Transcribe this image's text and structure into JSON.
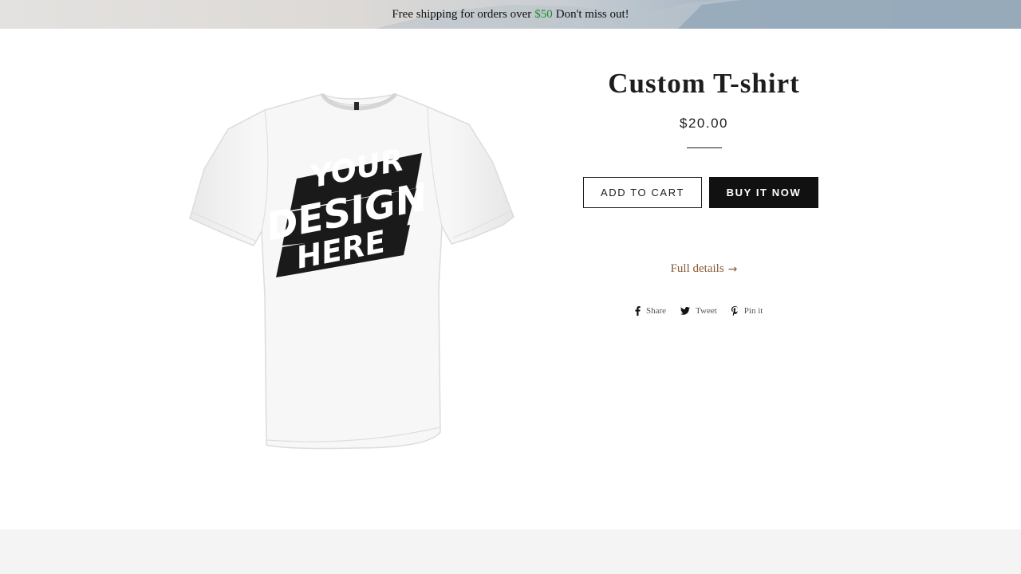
{
  "announcement": {
    "text_before": "Free shipping for orders over",
    "amount": "$50",
    "text_after": "Don't miss out!"
  },
  "product": {
    "image_alt": "White t-shirt with YOUR DESIGN HERE print",
    "print_lines": [
      "YOUR",
      "DESIGN",
      "HERE"
    ],
    "title": "Custom T-shirt",
    "price": "$20.00",
    "add_to_cart_label": "ADD TO CART",
    "buy_now_label": "BUY IT NOW",
    "full_details_label": "Full details",
    "full_details_icon": "arrow-right-icon"
  },
  "share": {
    "facebook_label": "Share",
    "twitter_label": "Tweet",
    "pinterest_label": "Pin it"
  },
  "colors": {
    "accent_green": "#1e8a2e",
    "link_brown": "#8a5a32",
    "button_dark": "#111111"
  }
}
